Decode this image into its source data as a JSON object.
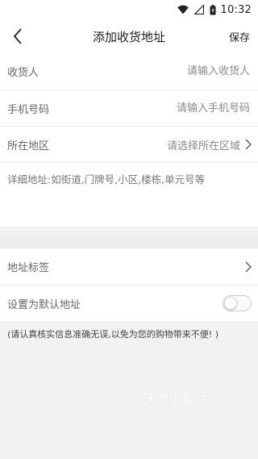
{
  "status_bar": {
    "time": "10:32"
  },
  "header": {
    "title": "添加收货地址",
    "save_label": "保存"
  },
  "form": {
    "receiver": {
      "label": "收货人",
      "placeholder": "请输入收货人"
    },
    "phone": {
      "label": "手机号码",
      "placeholder": "请输入手机号码"
    },
    "region": {
      "label": "所在地区",
      "placeholder": "请选择所在区域"
    },
    "detail": {
      "placeholder": "详细地址:如街道,门牌号,小区,楼栋,单元号等"
    },
    "tag": {
      "label": "地址标签"
    },
    "default": {
      "label": "设置为默认地址",
      "enabled": false
    }
  },
  "note": "(请认真核实信息准确无误,以免为您的购物带来不便! )",
  "watermark": "沃德下载站",
  "colors": {
    "background": "#f2f2f2",
    "card": "#ffffff",
    "divider": "#ececec"
  }
}
